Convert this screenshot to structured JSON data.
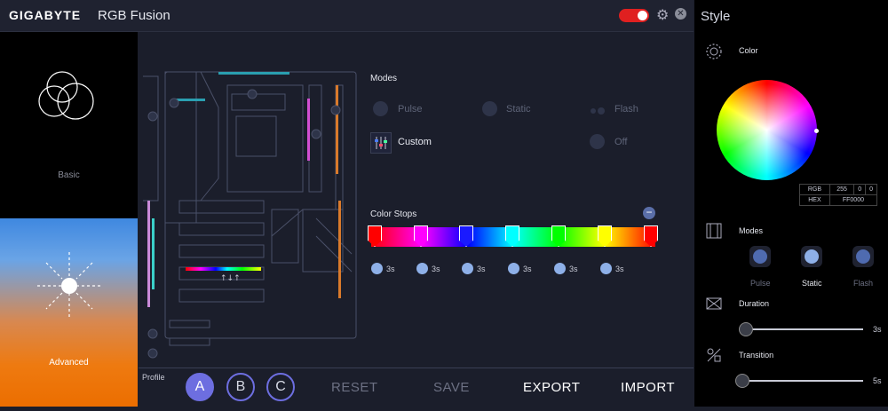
{
  "app": {
    "brand": "GIGABYTE",
    "title": "RGB Fusion"
  },
  "left": {
    "basic_label": "Basic",
    "advanced_label": "Advanced"
  },
  "modes": {
    "title": "Modes",
    "pulse": "Pulse",
    "static": "Static",
    "flash": "Flash",
    "custom": "Custom",
    "off": "Off"
  },
  "color_stops": {
    "title": "Color Stops",
    "times": [
      "3s",
      "3s",
      "3s",
      "3s",
      "3s",
      "3s"
    ]
  },
  "bottom": {
    "profile_label": "Profile",
    "profiles": [
      "A",
      "B",
      "C"
    ],
    "reset": "RESET",
    "save": "SAVE",
    "export": "EXPORT",
    "import": "IMPORT"
  },
  "style_panel": {
    "title": "Style",
    "color_label": "Color",
    "rgb_label": "RGB",
    "r": "255",
    "g": "0",
    "b": "0",
    "hex_label": "HEX",
    "hex": "FF0000",
    "modes_label": "Modes",
    "pulse": "Pulse",
    "static": "Static",
    "flash": "Flash",
    "duration_label": "Duration",
    "duration_value": "3s",
    "transition_label": "Transition",
    "transition_value": "5s"
  },
  "colors": {
    "accent": "#6d6ee0",
    "power_on": "#e02020",
    "advanced_top": "#3f88e0",
    "advanced_bottom": "#ec6e00"
  }
}
